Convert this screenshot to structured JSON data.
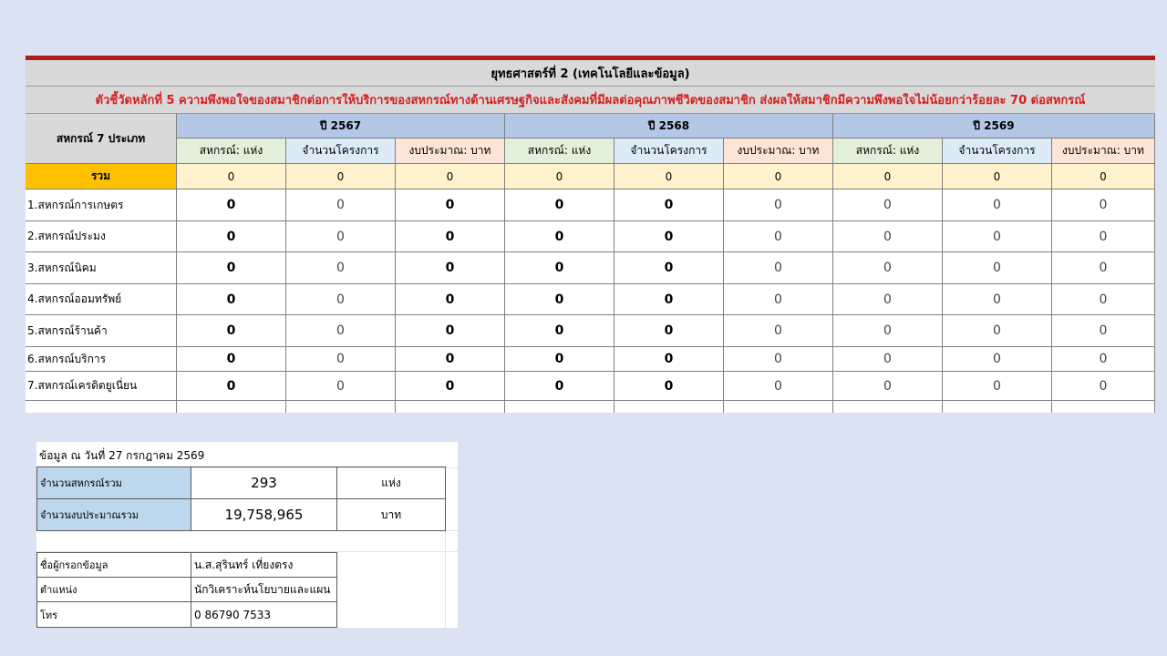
{
  "sheet": {
    "title": "ยุทธศาสตร์ที่ 2  (เทคโนโลยีและข้อมูล)",
    "kpi": "ตัวชี้วัดหลักที่ 5 ความพึงพอใจของสมาชิกต่อการให้บริการของสหกรณ์ทางด้านเศรษฐกิจและสังคมที่มีผลต่อคุณภาพชีวิตของสมาชิก ส่งผลให้สมาชิกมีความพึงพอใจไม่น้อยกว่าร้อยละ 70 ต่อสหกรณ์",
    "left_header": "สหกรณ์ 7 ประเภท",
    "years": [
      "ปี 2567",
      "ปี 2568",
      "ปี 2569"
    ],
    "sub_headers": [
      "สหกรณ์: แห่ง",
      "จำนวนโครงการ",
      "งบประมาณ: บาท"
    ],
    "total_label": "รวม",
    "total_values": [
      "0",
      "0",
      "0",
      "0",
      "0",
      "0",
      "0",
      "0",
      "0"
    ],
    "rows": [
      {
        "label": "1.สหกรณ์การเกษตร",
        "values": [
          "0",
          "0",
          "0",
          "0",
          "0",
          "0",
          "0",
          "0",
          "0"
        ]
      },
      {
        "label": "2.สหกรณ์ประมง",
        "values": [
          "0",
          "0",
          "0",
          "0",
          "0",
          "0",
          "0",
          "0",
          "0"
        ]
      },
      {
        "label": "3.สหกรณ์นิคม",
        "values": [
          "0",
          "0",
          "0",
          "0",
          "0",
          "0",
          "0",
          "0",
          "0"
        ]
      },
      {
        "label": "4.สหกรณ์ออมทรัพย์",
        "values": [
          "0",
          "0",
          "0",
          "0",
          "0",
          "0",
          "0",
          "0",
          "0"
        ]
      },
      {
        "label": "5.สหกรณ์ร้านค้า",
        "values": [
          "0",
          "0",
          "0",
          "0",
          "0",
          "0",
          "0",
          "0",
          "0"
        ]
      },
      {
        "label": "6.สหกรณ์บริการ",
        "values": [
          "0",
          "0",
          "0",
          "0",
          "0",
          "0",
          "0",
          "0",
          "0"
        ]
      },
      {
        "label": "7.สหกรณ์เครดิตยูเนี่ยน",
        "values": [
          "0",
          "0",
          "0",
          "0",
          "0",
          "0",
          "0",
          "0",
          "0"
        ]
      }
    ]
  },
  "info": {
    "as_of": "ข้อมูล ณ วันที่  27 กรกฎาคม 2569",
    "coop_total_label": "จำนวนสหกรณ์รวม",
    "coop_total_value": "293",
    "coop_total_unit": "แห่ง",
    "budget_total_label": "จำนวนงบประมาณรวม",
    "budget_total_value": "19,758,965",
    "budget_total_unit": "บาท",
    "recorder_label": "ชื่อผู้กรอกข้อมูล",
    "recorder_value": "น.ส.สุรินทร์ เที่ยงตรง",
    "position_label": "ตำแหน่ง",
    "position_value": "นักวิเคราะห์นโยบายและแผน",
    "phone_label": "โทร",
    "phone_value": "0 86790 7533"
  },
  "colors": {
    "background": "#dbe3f3",
    "top_bar": "#b31b1b",
    "kpi_text": "#d42020",
    "year_header": "#b4c7e7",
    "total_label_bg": "#ffc000",
    "total_row_bg": "#fff2cc"
  }
}
